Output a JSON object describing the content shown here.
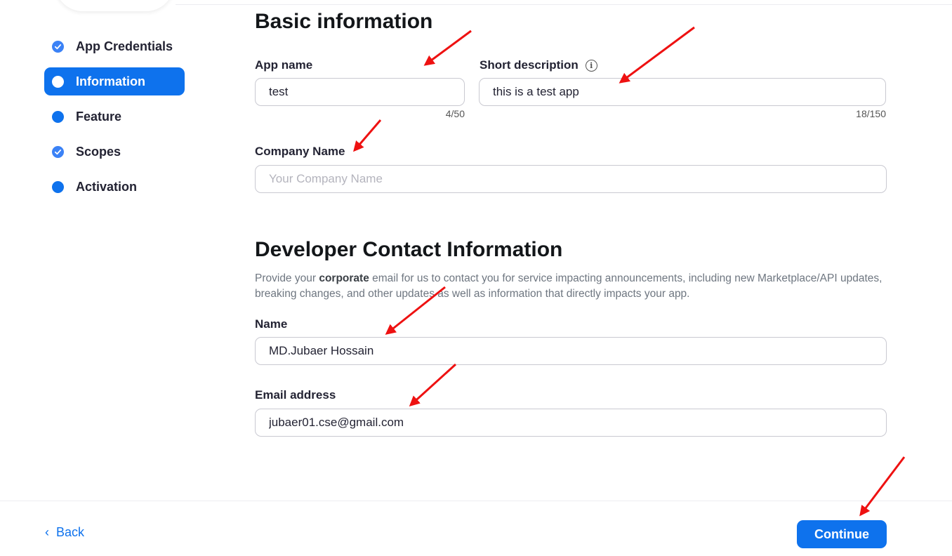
{
  "sidebar": {
    "items": [
      {
        "label": "App Credentials",
        "state": "check-icon"
      },
      {
        "label": "Information",
        "state": "active"
      },
      {
        "label": "Feature",
        "state": "dot"
      },
      {
        "label": "Scopes",
        "state": "check-icon"
      },
      {
        "label": "Activation",
        "state": "dot"
      }
    ]
  },
  "basic": {
    "heading": "Basic information",
    "app_name_label": "App name",
    "app_name_value": "test",
    "app_name_counter": "4/50",
    "short_desc_label": "Short description",
    "short_desc_value": "this is a test app",
    "short_desc_counter": "18/150",
    "company_label": "Company Name",
    "company_placeholder": "Your Company Name"
  },
  "contact": {
    "heading": "Developer Contact Information",
    "desc_prefix": "Provide your ",
    "desc_bold": "corporate",
    "desc_suffix": " email for us to contact you for service impacting announcements, including new Marketplace/API updates, breaking changes, and other updates as well as information that directly impacts your app.",
    "name_label": "Name",
    "name_value": "MD.Jubaer Hossain",
    "email_label": "Email address",
    "email_value": "jubaer01.cse@gmail.com"
  },
  "footer": {
    "back_label": "Back",
    "continue_label": "Continue"
  },
  "colors": {
    "accent": "#0e72ed",
    "annotation_arrow": "#ee1111"
  }
}
